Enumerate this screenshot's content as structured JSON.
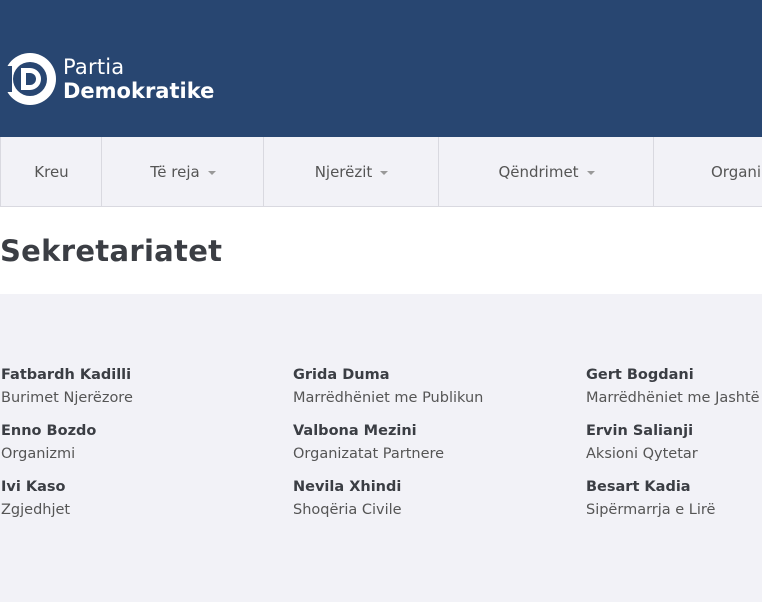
{
  "header": {
    "logo_line1": "Partia",
    "logo_line2": "Demokratike",
    "background_color": "#284671"
  },
  "nav": {
    "items": [
      {
        "label": "Kreu",
        "has_caret": false
      },
      {
        "label": "Të reja",
        "has_caret": true
      },
      {
        "label": "Njerëzit",
        "has_caret": true
      },
      {
        "label": "Qëndrimet",
        "has_caret": true
      },
      {
        "label": "Organi",
        "has_caret": false
      }
    ]
  },
  "page": {
    "title": "Sekretariatet"
  },
  "people": [
    {
      "name": "Fatbardh Kadilli",
      "role": "Burimet Njerëzore"
    },
    {
      "name": "Grida Duma",
      "role": "Marrëdhëniet me Publikun"
    },
    {
      "name": "Gert Bogdani",
      "role": "Marrëdhëniet me Jashtë"
    },
    {
      "name": "Enno Bozdo",
      "role": "Organizmi"
    },
    {
      "name": "Valbona Mezini",
      "role": "Organizatat Partnere"
    },
    {
      "name": "Ervin Salianji",
      "role": "Aksioni Qytetar"
    },
    {
      "name": "Ivi Kaso",
      "role": "Zgjedhjet"
    },
    {
      "name": "Nevila Xhindi",
      "role": "Shoqëria Civile"
    },
    {
      "name": "Besart Kadia",
      "role": "Sipërmarrja e Lirë"
    }
  ]
}
